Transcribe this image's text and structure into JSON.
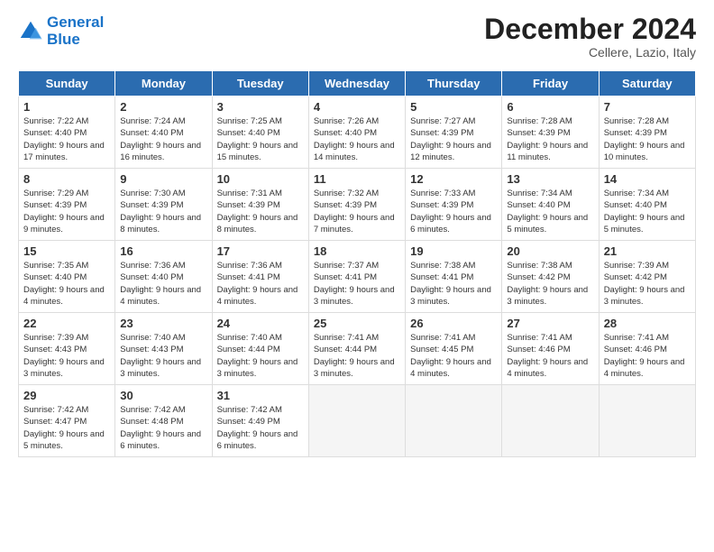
{
  "header": {
    "logo_line1": "General",
    "logo_line2": "Blue",
    "month": "December 2024",
    "location": "Cellere, Lazio, Italy"
  },
  "days_of_week": [
    "Sunday",
    "Monday",
    "Tuesday",
    "Wednesday",
    "Thursday",
    "Friday",
    "Saturday"
  ],
  "weeks": [
    [
      {
        "day": "1",
        "sunrise": "Sunrise: 7:22 AM",
        "sunset": "Sunset: 4:40 PM",
        "daylight": "Daylight: 9 hours and 17 minutes."
      },
      {
        "day": "2",
        "sunrise": "Sunrise: 7:24 AM",
        "sunset": "Sunset: 4:40 PM",
        "daylight": "Daylight: 9 hours and 16 minutes."
      },
      {
        "day": "3",
        "sunrise": "Sunrise: 7:25 AM",
        "sunset": "Sunset: 4:40 PM",
        "daylight": "Daylight: 9 hours and 15 minutes."
      },
      {
        "day": "4",
        "sunrise": "Sunrise: 7:26 AM",
        "sunset": "Sunset: 4:40 PM",
        "daylight": "Daylight: 9 hours and 14 minutes."
      },
      {
        "day": "5",
        "sunrise": "Sunrise: 7:27 AM",
        "sunset": "Sunset: 4:39 PM",
        "daylight": "Daylight: 9 hours and 12 minutes."
      },
      {
        "day": "6",
        "sunrise": "Sunrise: 7:28 AM",
        "sunset": "Sunset: 4:39 PM",
        "daylight": "Daylight: 9 hours and 11 minutes."
      },
      {
        "day": "7",
        "sunrise": "Sunrise: 7:28 AM",
        "sunset": "Sunset: 4:39 PM",
        "daylight": "Daylight: 9 hours and 10 minutes."
      }
    ],
    [
      {
        "day": "8",
        "sunrise": "Sunrise: 7:29 AM",
        "sunset": "Sunset: 4:39 PM",
        "daylight": "Daylight: 9 hours and 9 minutes."
      },
      {
        "day": "9",
        "sunrise": "Sunrise: 7:30 AM",
        "sunset": "Sunset: 4:39 PM",
        "daylight": "Daylight: 9 hours and 8 minutes."
      },
      {
        "day": "10",
        "sunrise": "Sunrise: 7:31 AM",
        "sunset": "Sunset: 4:39 PM",
        "daylight": "Daylight: 9 hours and 8 minutes."
      },
      {
        "day": "11",
        "sunrise": "Sunrise: 7:32 AM",
        "sunset": "Sunset: 4:39 PM",
        "daylight": "Daylight: 9 hours and 7 minutes."
      },
      {
        "day": "12",
        "sunrise": "Sunrise: 7:33 AM",
        "sunset": "Sunset: 4:39 PM",
        "daylight": "Daylight: 9 hours and 6 minutes."
      },
      {
        "day": "13",
        "sunrise": "Sunrise: 7:34 AM",
        "sunset": "Sunset: 4:40 PM",
        "daylight": "Daylight: 9 hours and 5 minutes."
      },
      {
        "day": "14",
        "sunrise": "Sunrise: 7:34 AM",
        "sunset": "Sunset: 4:40 PM",
        "daylight": "Daylight: 9 hours and 5 minutes."
      }
    ],
    [
      {
        "day": "15",
        "sunrise": "Sunrise: 7:35 AM",
        "sunset": "Sunset: 4:40 PM",
        "daylight": "Daylight: 9 hours and 4 minutes."
      },
      {
        "day": "16",
        "sunrise": "Sunrise: 7:36 AM",
        "sunset": "Sunset: 4:40 PM",
        "daylight": "Daylight: 9 hours and 4 minutes."
      },
      {
        "day": "17",
        "sunrise": "Sunrise: 7:36 AM",
        "sunset": "Sunset: 4:41 PM",
        "daylight": "Daylight: 9 hours and 4 minutes."
      },
      {
        "day": "18",
        "sunrise": "Sunrise: 7:37 AM",
        "sunset": "Sunset: 4:41 PM",
        "daylight": "Daylight: 9 hours and 3 minutes."
      },
      {
        "day": "19",
        "sunrise": "Sunrise: 7:38 AM",
        "sunset": "Sunset: 4:41 PM",
        "daylight": "Daylight: 9 hours and 3 minutes."
      },
      {
        "day": "20",
        "sunrise": "Sunrise: 7:38 AM",
        "sunset": "Sunset: 4:42 PM",
        "daylight": "Daylight: 9 hours and 3 minutes."
      },
      {
        "day": "21",
        "sunrise": "Sunrise: 7:39 AM",
        "sunset": "Sunset: 4:42 PM",
        "daylight": "Daylight: 9 hours and 3 minutes."
      }
    ],
    [
      {
        "day": "22",
        "sunrise": "Sunrise: 7:39 AM",
        "sunset": "Sunset: 4:43 PM",
        "daylight": "Daylight: 9 hours and 3 minutes."
      },
      {
        "day": "23",
        "sunrise": "Sunrise: 7:40 AM",
        "sunset": "Sunset: 4:43 PM",
        "daylight": "Daylight: 9 hours and 3 minutes."
      },
      {
        "day": "24",
        "sunrise": "Sunrise: 7:40 AM",
        "sunset": "Sunset: 4:44 PM",
        "daylight": "Daylight: 9 hours and 3 minutes."
      },
      {
        "day": "25",
        "sunrise": "Sunrise: 7:41 AM",
        "sunset": "Sunset: 4:44 PM",
        "daylight": "Daylight: 9 hours and 3 minutes."
      },
      {
        "day": "26",
        "sunrise": "Sunrise: 7:41 AM",
        "sunset": "Sunset: 4:45 PM",
        "daylight": "Daylight: 9 hours and 4 minutes."
      },
      {
        "day": "27",
        "sunrise": "Sunrise: 7:41 AM",
        "sunset": "Sunset: 4:46 PM",
        "daylight": "Daylight: 9 hours and 4 minutes."
      },
      {
        "day": "28",
        "sunrise": "Sunrise: 7:41 AM",
        "sunset": "Sunset: 4:46 PM",
        "daylight": "Daylight: 9 hours and 4 minutes."
      }
    ],
    [
      {
        "day": "29",
        "sunrise": "Sunrise: 7:42 AM",
        "sunset": "Sunset: 4:47 PM",
        "daylight": "Daylight: 9 hours and 5 minutes."
      },
      {
        "day": "30",
        "sunrise": "Sunrise: 7:42 AM",
        "sunset": "Sunset: 4:48 PM",
        "daylight": "Daylight: 9 hours and 6 minutes."
      },
      {
        "day": "31",
        "sunrise": "Sunrise: 7:42 AM",
        "sunset": "Sunset: 4:49 PM",
        "daylight": "Daylight: 9 hours and 6 minutes."
      },
      null,
      null,
      null,
      null
    ]
  ]
}
